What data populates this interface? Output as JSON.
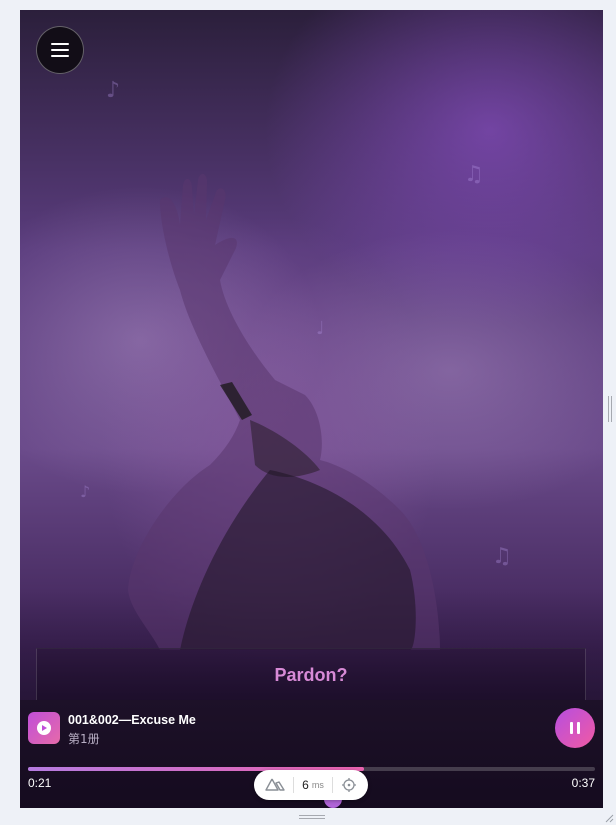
{
  "menu": {
    "icon": "hamburger-menu-icon"
  },
  "phrase": {
    "text": "Pardon?"
  },
  "player": {
    "cover_icon": "play-circle-icon",
    "title": "001&002—Excuse Me",
    "subtitle": "第1册",
    "state_icon": "pause-icon",
    "current_time": "0:21",
    "total_time": "0:37",
    "progress_fraction": 0.592
  },
  "devtools": {
    "logo_icon": "nuxt-logo-icon",
    "ms_value": "6",
    "ms_unit": "ms",
    "inspect_icon": "crosshair-icon"
  },
  "colors": {
    "accent": "#b64ee0",
    "accent_pink": "#f15aa3",
    "phrase_text": "#d78ad6",
    "player_bg": "#150b1f"
  }
}
